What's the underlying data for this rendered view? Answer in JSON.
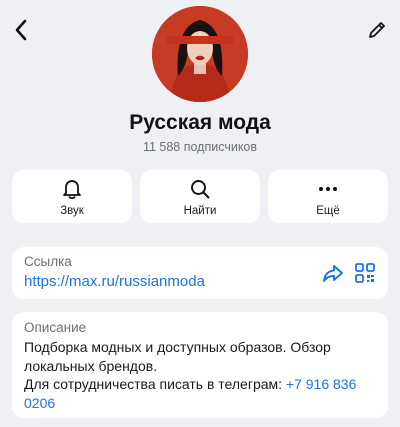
{
  "profile": {
    "name": "Русская мода",
    "subscribers": "11 588 подписчиков"
  },
  "actions": [
    {
      "label": "Звук",
      "icon": "bell-icon"
    },
    {
      "label": "Найти",
      "icon": "search-icon"
    },
    {
      "label": "Ещё",
      "icon": "more-icon"
    }
  ],
  "link": {
    "label": "Ссылка",
    "url": "https://max.ru/russianmoda"
  },
  "description": {
    "label": "Описание",
    "line1": "Подборка модных и доступных образов. Обзор локальных брендов.",
    "line2": "Для сотрудничества писать в телеграм: ",
    "phone": "+7 916 836 0206"
  },
  "colors": {
    "accent": "#1a73e8",
    "background": "#eef0f4",
    "avatar_bg": "#c73a23"
  }
}
